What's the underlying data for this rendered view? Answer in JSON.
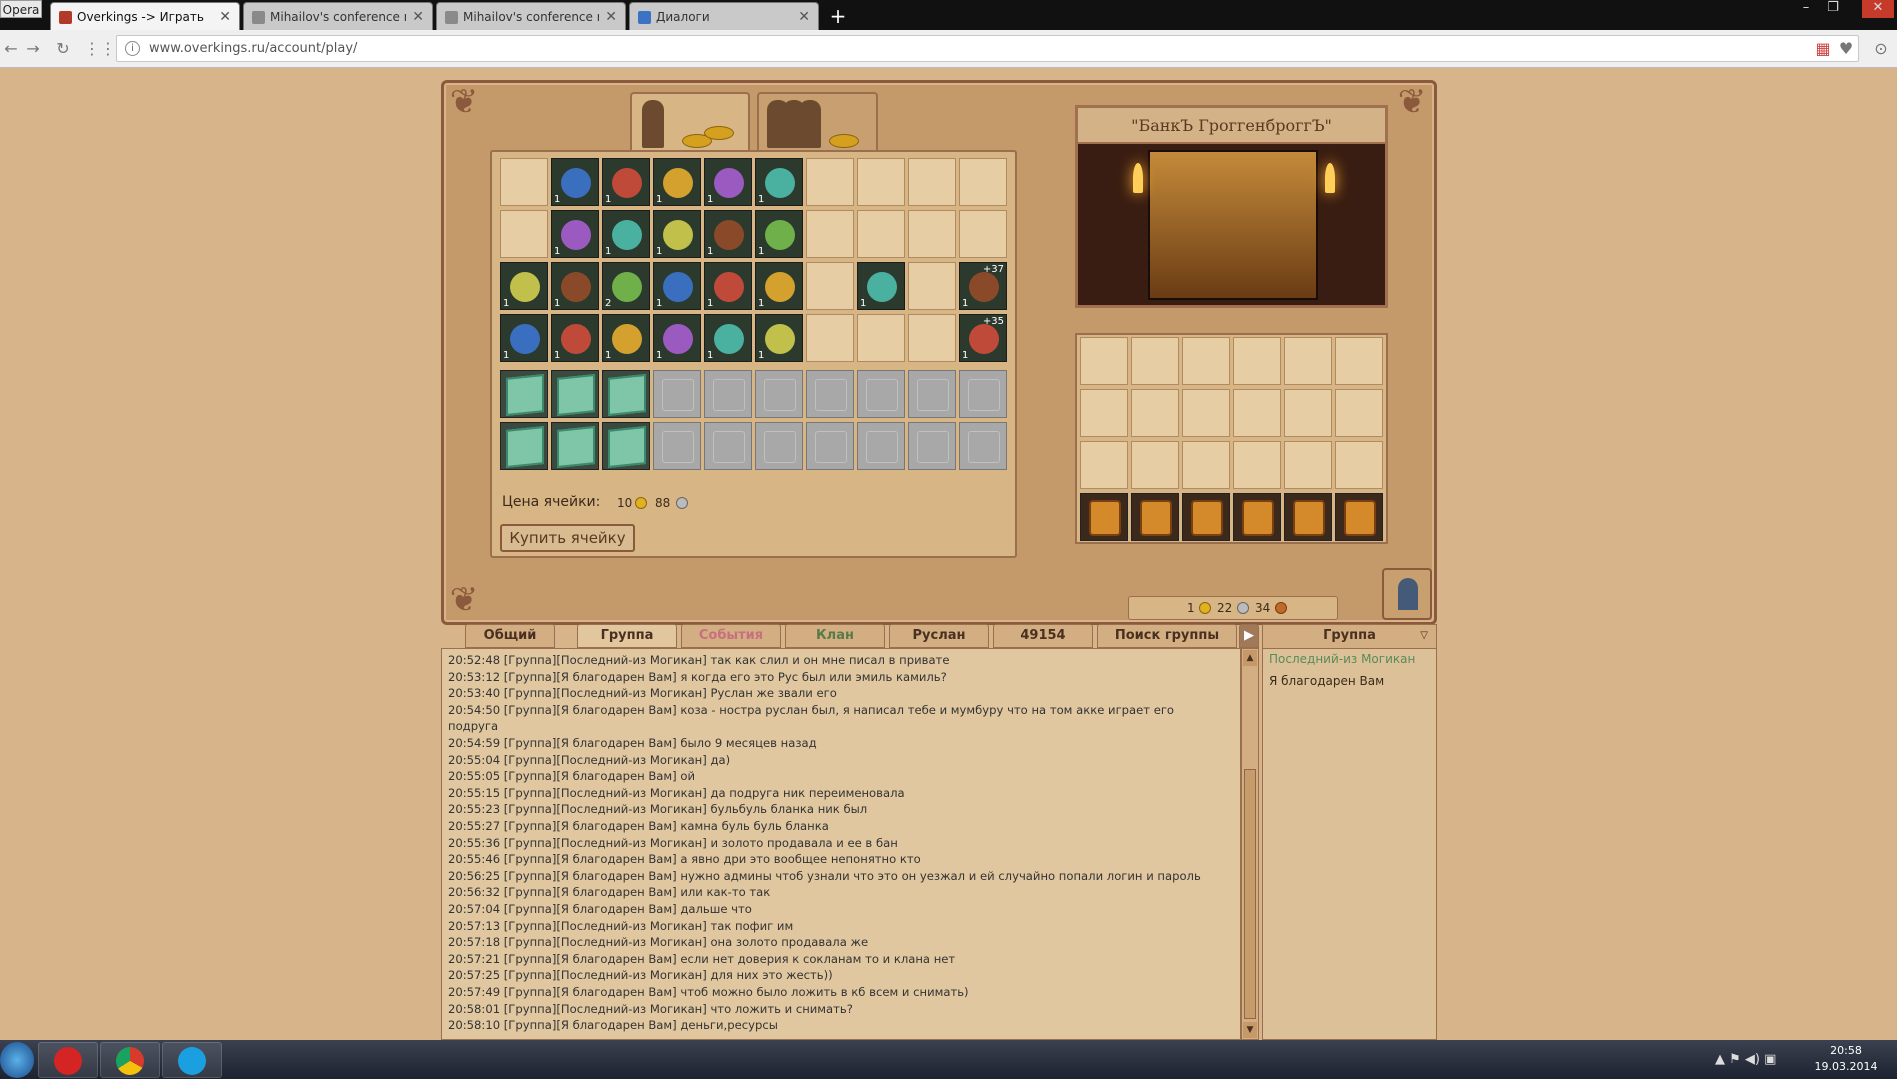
{
  "browser": {
    "menu": "Opera",
    "tabs": [
      {
        "title": "Overkings -> Играть",
        "active": true
      },
      {
        "title": "Mihailov's conference ro",
        "active": false
      },
      {
        "title": "Mihailov's conference ro",
        "active": false
      },
      {
        "title": "Диалоги",
        "active": false
      }
    ],
    "url": "www.overkings.ru/account/play/"
  },
  "bank": {
    "title": "\"БанкЪ ГроггенброггЪ\""
  },
  "inventory": {
    "rows": [
      [
        null,
        {
          "qty": "1"
        },
        {
          "qty": "1"
        },
        {
          "qty": "1"
        },
        {
          "qty": "1"
        },
        {
          "qty": "1"
        },
        null,
        null,
        null,
        null
      ],
      [
        null,
        {
          "qty": "1"
        },
        {
          "qty": "1"
        },
        {
          "qty": "1"
        },
        {
          "qty": "1"
        },
        {
          "qty": "1"
        },
        null,
        null,
        null,
        null
      ],
      [
        {
          "qty": "1"
        },
        {
          "qty": "1"
        },
        {
          "qty": "2"
        },
        {
          "qty": "1"
        },
        {
          "qty": "1"
        },
        {
          "qty": "1"
        },
        null,
        {
          "qty": "1"
        },
        null,
        {
          "qty": "1",
          "plus": "+37"
        }
      ],
      [
        {
          "qty": "1"
        },
        {
          "qty": "1"
        },
        {
          "qty": "1"
        },
        {
          "qty": "1"
        },
        {
          "qty": "1"
        },
        {
          "qty": "1"
        },
        null,
        null,
        null,
        {
          "qty": "1",
          "plus": "+35"
        }
      ]
    ],
    "price_label": "Цена ячейки:",
    "price_gold": "10",
    "price_silver": "88",
    "buy_button": "Купить ячейку"
  },
  "money": {
    "gold": "1",
    "silver": "22",
    "copper": "34"
  },
  "chat": {
    "tabs": [
      "Общий",
      "Группа",
      "События",
      "Клан",
      "Руслан",
      "49154",
      "Поиск группы"
    ],
    "messages": [
      "20:52:48 [Группа][Последний-из Могикан] так как слил и он мне писал в привате",
      "20:53:12 [Группа][Я благодарен Вам] я когда его это Рус был или эмиль камиль?",
      "20:53:40 [Группа][Последний-из Могикан] Руслан же звали его",
      "20:54:50 [Группа][Я благодарен Вам] коза - ностра руслан был, я написал тебе и мумбуру что на том акке играет его",
      "подруга",
      "20:54:59 [Группа][Я благодарен Вам] было 9 месяцев назад",
      "20:55:04 [Группа][Последний-из Могикан] да)",
      "20:55:05 [Группа][Я благодарен Вам] ой",
      "20:55:15 [Группа][Последний-из Могикан] да подруга ник переименовала",
      "20:55:23 [Группа][Последний-из Могикан] бульбуль бланка ник был",
      "20:55:27 [Группа][Я благодарен Вам] камна буль буль бланка",
      "20:55:36 [Группа][Последний-из Могикан] и золото продавала и ее в бан",
      "20:55:46 [Группа][Я благодарен Вам] а явно дри это вообщее непонятно кто",
      "20:56:25 [Группа][Я благодарен Вам] нужно админы чтоб узнали что это он уезжал и ей случайно попали логин и пароль",
      "20:56:32 [Группа][Я благодарен Вам] или как-то так",
      "20:57:04 [Группа][Я благодарен Вам] дальше что",
      "20:57:13 [Группа][Последний-из Могикан] так пофиг им",
      "20:57:18 [Группа][Последний-из Могикан] она золото продавала же",
      "20:57:21 [Группа][Я благодарен Вам] если нет доверия к сокланам то и клана нет",
      "20:57:25 [Группа][Последний-из Могикан] для них это жесть))",
      "20:57:49 [Группа][Я благодарен Вам] чтоб можно было ложить в кб всем и снимать)",
      "20:58:01 [Группа][Последний-из Могикан] что ложить и снимать?",
      "20:58:10 [Группа][Я благодарен Вам] деньги,ресурсы"
    ]
  },
  "group_panel": {
    "title": "Группа",
    "members": [
      "Последний-из Могикан",
      "Я благодарен Вам"
    ]
  },
  "taskbar": {
    "time": "20:58",
    "date": "19.03.2014"
  }
}
